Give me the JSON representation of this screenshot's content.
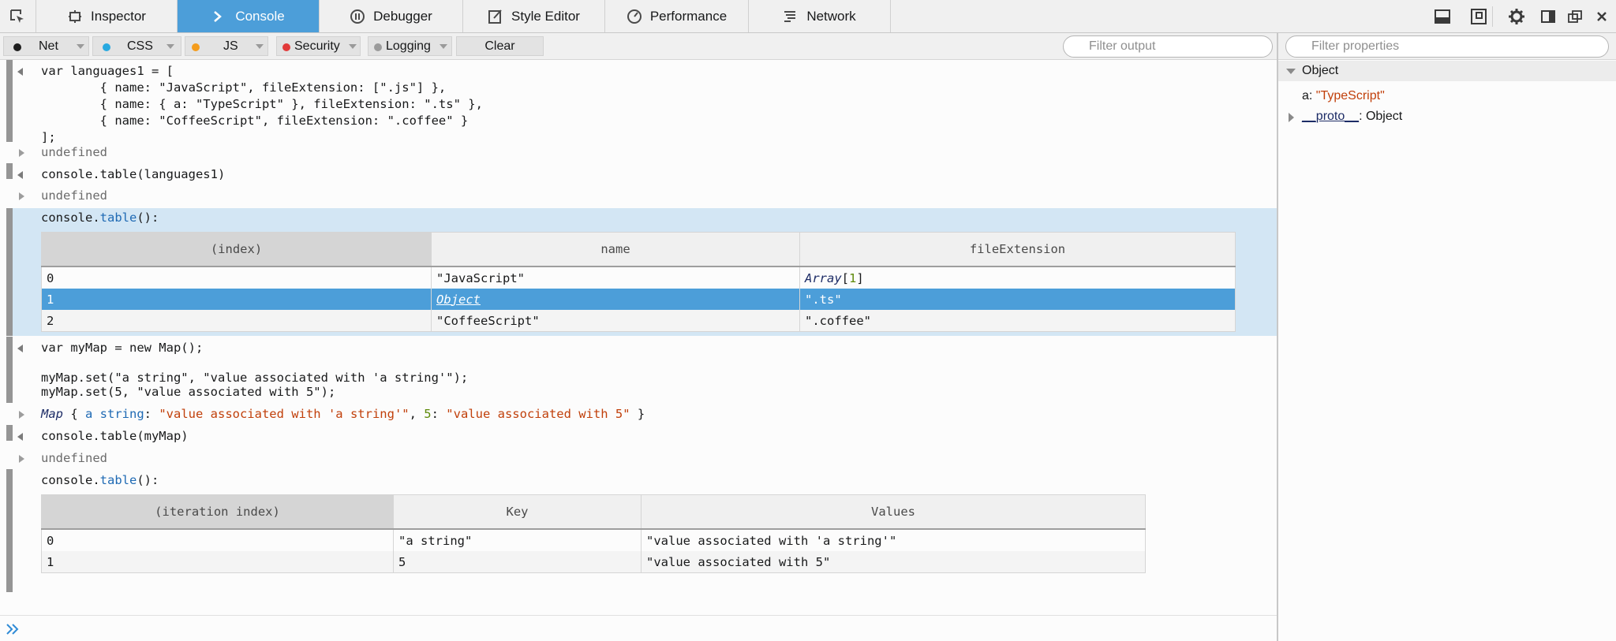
{
  "toolbar": {
    "tabs": [
      {
        "label": "Inspector",
        "icon": "inspector-icon"
      },
      {
        "label": "Console",
        "icon": "console-icon"
      },
      {
        "label": "Debugger",
        "icon": "debugger-icon"
      },
      {
        "label": "Style Editor",
        "icon": "style-editor-icon"
      },
      {
        "label": "Performance",
        "icon": "performance-icon"
      },
      {
        "label": "Network",
        "icon": "network-icon"
      }
    ],
    "selected_tab": "Console",
    "right_icons": [
      "split-console-icon",
      "scratchpad-icon",
      "settings-gear-icon",
      "dock-side-icon",
      "undock-window-icon",
      "close-icon"
    ],
    "accent_color": "#4c9ed9"
  },
  "filter_bar": {
    "buttons": [
      {
        "label": "Net",
        "dot_color": "#1e1e1e"
      },
      {
        "label": "CSS",
        "dot_color": "#28a9e0"
      },
      {
        "label": "JS",
        "dot_color": "#f49c1c"
      },
      {
        "label": "Security",
        "dot_color": "#e23a3a"
      },
      {
        "label": "Logging",
        "dot_color": "#9b9b9b"
      }
    ],
    "clear_label": "Clear",
    "filter_placeholder": "Filter output"
  },
  "console": {
    "input1": [
      "var languages1 = [",
      "        { name: \"JavaScript\", fileExtension: [\".js\"] },",
      "        { name: { a: \"TypeScript\" }, fileExtension: \".ts\" },",
      "        { name: \"CoffeeScript\", fileExtension: \".coffee\" }",
      "];"
    ],
    "undefined": "undefined",
    "cmd_table1": "console.table(languages1)",
    "table_label_prefix": "console.",
    "table_label_method": "table",
    "table_label_suffix": "():",
    "table1": {
      "headers": [
        "(index)",
        "name",
        "fileExtension"
      ],
      "rows": [
        [
          "0",
          "\"JavaScript\"",
          "Array[1]"
        ],
        [
          "1",
          "Object",
          "\".ts\""
        ],
        [
          "2",
          "\"CoffeeScript\"",
          "\".coffee\""
        ]
      ],
      "array_type": "Array",
      "array_len": "1",
      "selected_row": 1
    },
    "input2": [
      "var myMap = new Map();",
      "",
      "myMap.set(\"a string\", \"value associated with 'a string'\");",
      "myMap.set(5, \"value associated with 5\");"
    ],
    "map_output": {
      "type": "Map",
      "key1": "a string",
      "val1": "\"value associated with 'a string'\"",
      "key2": "5",
      "val2": "\"value associated with 5\""
    },
    "cmd_table2": "console.table(myMap)",
    "table2": {
      "headers": [
        "(iteration index)",
        "Key",
        "Values"
      ],
      "rows": [
        [
          "0",
          "\"a string\"",
          "\"value associated with 'a string'\""
        ],
        [
          "1",
          "5",
          "\"value associated with 5\""
        ]
      ]
    }
  },
  "side_panel": {
    "filter_placeholder": "Filter properties",
    "header": "Object",
    "props": [
      {
        "name": "a",
        "value": "\"TypeScript\""
      },
      {
        "name": "__proto__",
        "value": "Object"
      }
    ]
  }
}
